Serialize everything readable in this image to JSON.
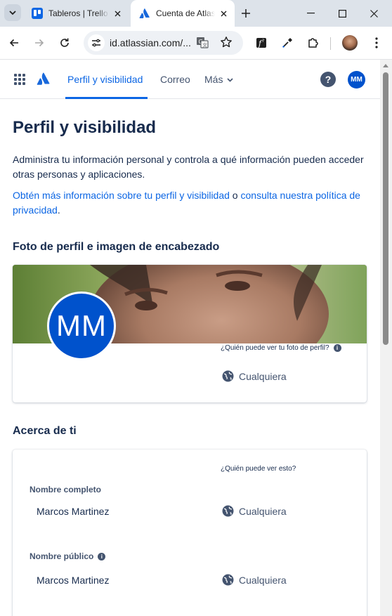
{
  "browser": {
    "tabs": [
      {
        "title": "Tableros | Trello",
        "active": false,
        "favicon": "trello-icon"
      },
      {
        "title": "Cuenta de Atlassian",
        "active": true,
        "favicon": "atlassian-icon"
      }
    ],
    "address": "id.atlassian.com/...",
    "icons": [
      "tab-search-icon",
      "new-tab-icon",
      "minimize-icon",
      "maximize-icon",
      "close-window-icon",
      "back-icon",
      "forward-icon",
      "reload-icon",
      "site-info-icon",
      "translate-icon",
      "bookmark-star-icon",
      "extension-f-icon",
      "eyedropper-icon",
      "extensions-puzzle-icon",
      "profile-avatar",
      "menu-icon"
    ]
  },
  "nav": {
    "items": [
      {
        "label": "Perfil y visibilidad",
        "active": true
      },
      {
        "label": "Correo",
        "active": false
      },
      {
        "label": "Más",
        "active": false
      }
    ],
    "avatar_initials": "MM",
    "help_glyph": "?"
  },
  "page": {
    "title": "Perfil y visibilidad",
    "intro": "Administra tu información personal y controla a qué información pueden acceder otras personas y aplicaciones.",
    "link1": "Obtén más información sobre tu perfil y visibilidad",
    "link_joiner": " o ",
    "link2": "consulta nuestra política de privacidad",
    "link_end": "."
  },
  "photo_section": {
    "heading": "Foto de perfil e imagen de encabezado",
    "avatar_initials": "MM",
    "who_can_see": "¿Quién puede ver tu foto de perfil?",
    "visibility": "Cualquiera"
  },
  "about_section": {
    "heading": "Acerca de ti",
    "who_can_see": "¿Quién puede ver esto?",
    "fields": [
      {
        "label": "Nombre completo",
        "value": "Marcos Martinez",
        "visibility": "Cualquiera"
      },
      {
        "label": "Nombre público",
        "value": "Marcos Martinez",
        "visibility": "Cualquiera"
      }
    ]
  },
  "colors": {
    "brand": "#0c66e4",
    "avatar": "#0052cc",
    "text": "#172b4d"
  }
}
